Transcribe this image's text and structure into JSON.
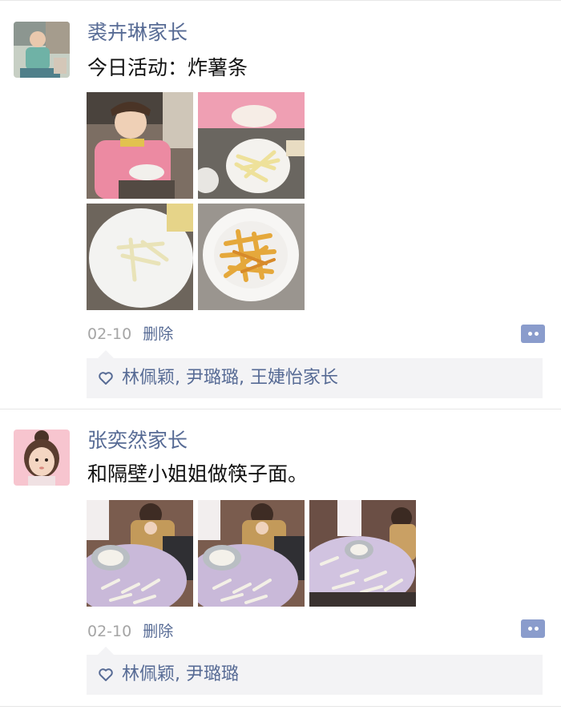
{
  "posts": [
    {
      "author": "裘卉琳家长",
      "text": "今日活动：炸薯条",
      "photos": [
        {
          "icon": "photo-child-kneading-dough"
        },
        {
          "icon": "photo-hands-making-fries"
        },
        {
          "icon": "photo-plate-raw-potato-strips"
        },
        {
          "icon": "photo-bowl-fried-fries"
        }
      ],
      "date": "02-10",
      "delete_label": "删除",
      "comment_icon": "comment-icon",
      "like_icon": "heart-icon",
      "likes": [
        "林佩颖",
        "尹璐璐",
        "王婕怡家长"
      ]
    },
    {
      "author": "张奕然家长",
      "text": "和隔壁小姐姐做筷子面。",
      "photos": [
        {
          "icon": "photo-children-making-noodles"
        },
        {
          "icon": "photo-children-making-noodles"
        },
        {
          "icon": "photo-table-with-noodles"
        }
      ],
      "date": "02-10",
      "delete_label": "删除",
      "comment_icon": "comment-icon",
      "like_icon": "heart-icon",
      "likes": [
        "林佩颖",
        "尹璐璐"
      ]
    }
  ],
  "colors": {
    "link": "#576b95",
    "date": "#a5a5a5",
    "like_bg": "#f3f3f5",
    "comment_button": "#8a9ccc"
  }
}
